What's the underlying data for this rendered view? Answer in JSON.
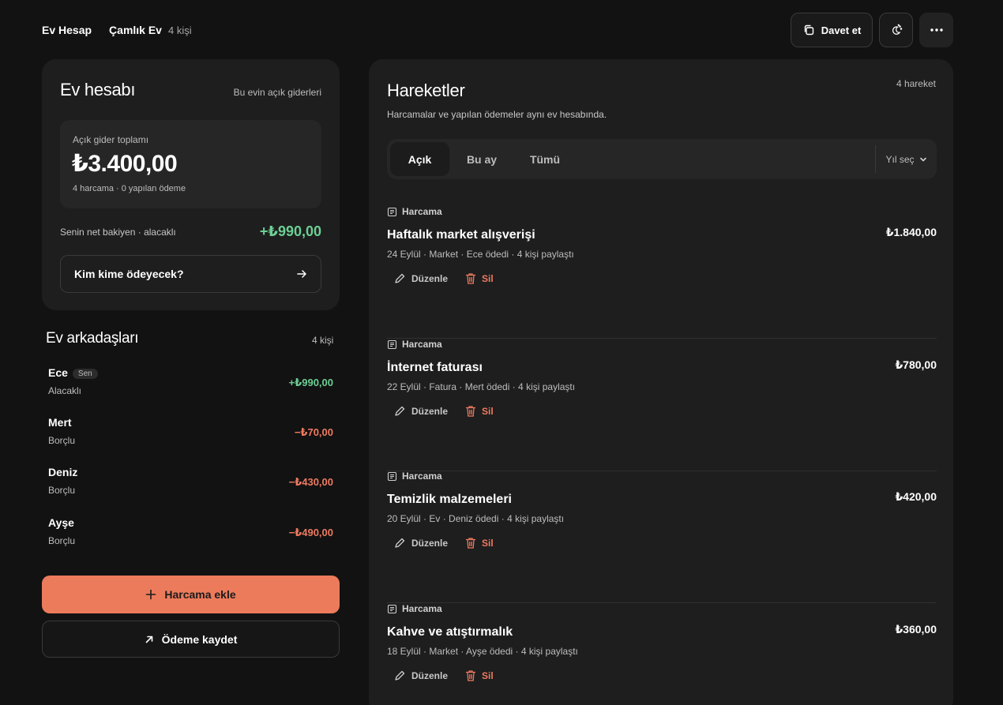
{
  "header": {
    "brand": "Ev Hesap",
    "house_name": "Çamlık Ev",
    "member_count": "4 kişi",
    "invite_label": "Davet et",
    "icons": {
      "invite": "copy-icon",
      "theme": "theme-toggle-icon",
      "more": "more-dots-icon"
    }
  },
  "summary": {
    "title": "Ev hesabı",
    "subtitle": "Bu evin açık giderleri",
    "total_label": "Açık gider toplamı",
    "total_value": "₺3.400,00",
    "total_meta": "4 harcama · 0 yapılan ödeme",
    "net_label": "Senin net bakiyen · alacaklı",
    "net_value": "+₺990,00",
    "who_pays_label": "Kim kime ödeyecek?"
  },
  "roommates": {
    "title": "Ev arkadaşları",
    "count": "4 kişi",
    "items": [
      {
        "name": "Ece",
        "badge": "Sen",
        "status": "Alacaklı",
        "amount": "+₺990,00",
        "sign": "pos"
      },
      {
        "name": "Mert",
        "badge": "",
        "status": "Borçlu",
        "amount": "−₺70,00",
        "sign": "neg"
      },
      {
        "name": "Deniz",
        "badge": "",
        "status": "Borçlu",
        "amount": "−₺430,00",
        "sign": "neg"
      },
      {
        "name": "Ayşe",
        "badge": "",
        "status": "Borçlu",
        "amount": "−₺490,00",
        "sign": "neg"
      }
    ]
  },
  "actions": {
    "add_expense": "Harcama ekle",
    "record_payment": "Ödeme kaydet"
  },
  "transactions": {
    "title": "Hareketler",
    "count": "4 hareket",
    "subtitle": "Harcamalar ve yapılan ödemeler aynı ev hesabında.",
    "tabs": [
      "Açık",
      "Bu ay",
      "Tümü"
    ],
    "active_tab": "Açık",
    "year_select": "Yıl seç",
    "edit_label": "Düzenle",
    "delete_label": "Sil",
    "items": [
      {
        "kind": "Harcama",
        "name": "Haftalık market alışverişi",
        "meta": "24 Eylül · Market · Ece ödedi · 4 kişi paylaştı",
        "amount": "₺1.840,00"
      },
      {
        "kind": "Harcama",
        "name": "İnternet faturası",
        "meta": "22 Eylül · Fatura · Mert ödedi · 4 kişi paylaştı",
        "amount": "₺780,00"
      },
      {
        "kind": "Harcama",
        "name": "Temizlik malzemeleri",
        "meta": "20 Eylül · Ev · Deniz ödedi · 4 kişi paylaştı",
        "amount": "₺420,00"
      },
      {
        "kind": "Harcama",
        "name": "Kahve ve atıştırmalık",
        "meta": "18 Eylül · Market · Ayşe ödedi · 4 kişi paylaştı",
        "amount": "₺360,00"
      }
    ]
  },
  "colors": {
    "accent": "#ec7b5c",
    "positive": "#6ccf94",
    "negative": "#ee7a60",
    "background": "#121212",
    "card": "#1e1e1e"
  }
}
